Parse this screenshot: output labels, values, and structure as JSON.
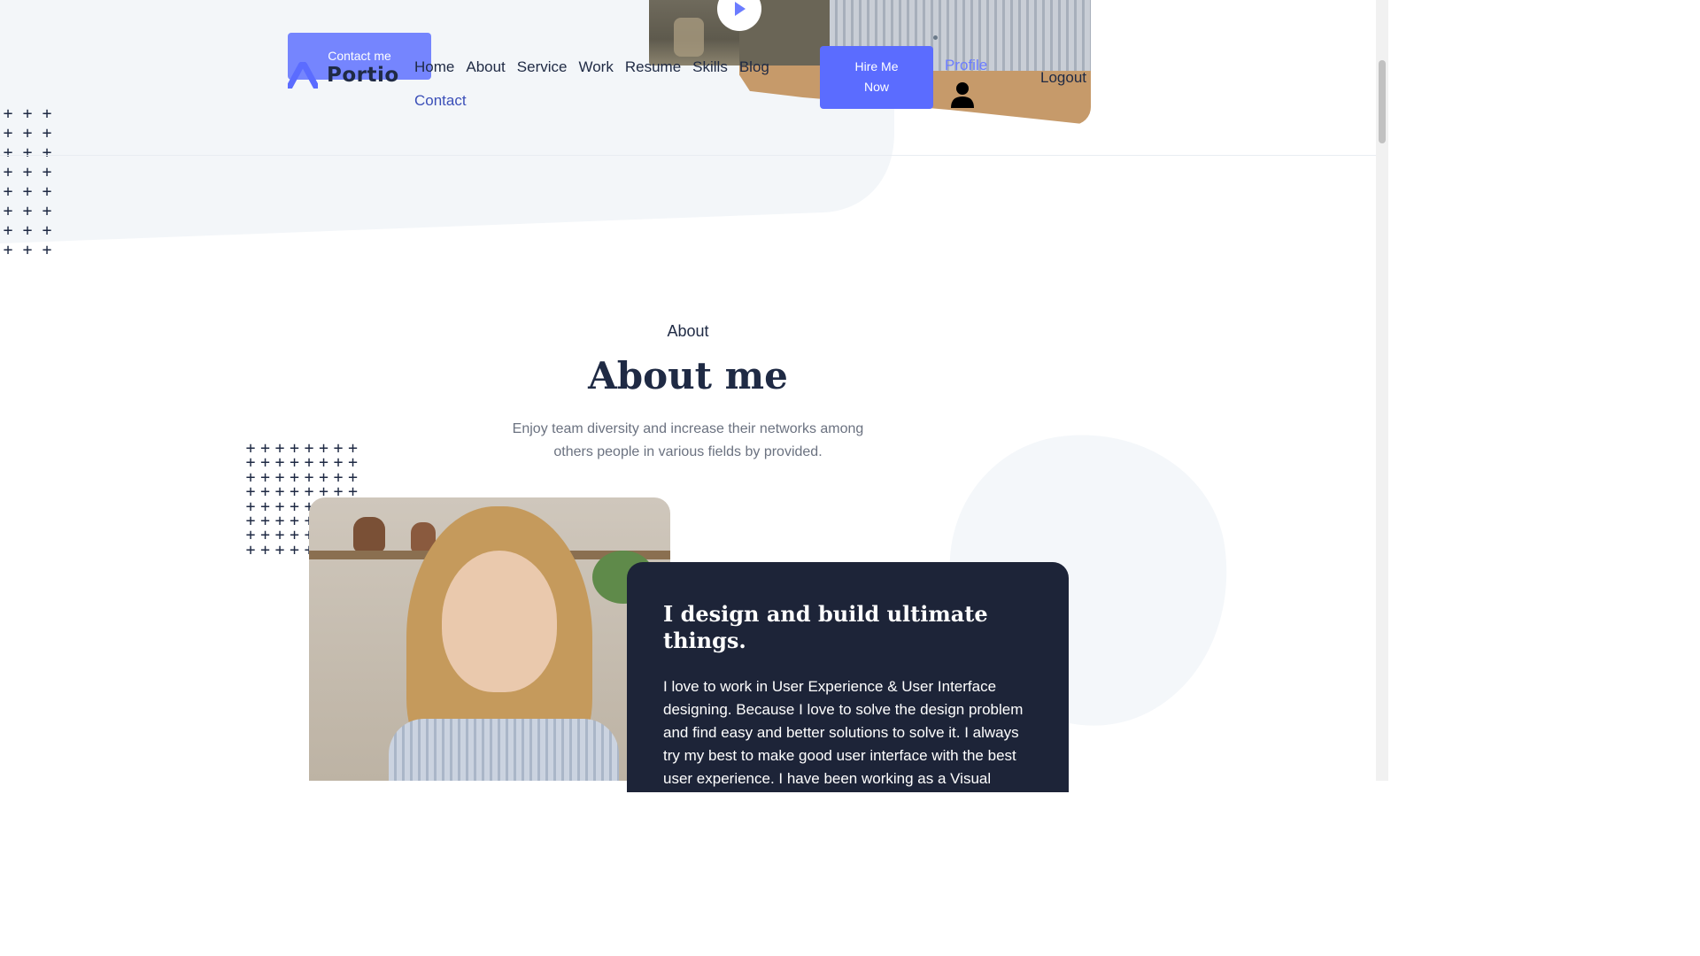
{
  "header": {
    "contact_button": "Contact me",
    "logo_text": "Portio",
    "nav": [
      "Home",
      "About",
      "Service",
      "Work",
      "Resume",
      "Skills",
      "Blog"
    ],
    "nav_second_row": "Contact",
    "hire_button_line1": "Hire Me",
    "hire_button_line2": "Now",
    "profile_link": "Profile",
    "logout_link": "Logout"
  },
  "about": {
    "eyebrow": "About",
    "title": "About me",
    "description": "Enjoy team diversity and increase their networks among others people in various fields by provided.",
    "card_title": "I design and build ultimate things.",
    "card_text": "I love to work in User Experience & User Interface designing. Because I love to solve the design problem and find easy and better solutions to solve it. I always try my best to make good user interface with the best user experience. I have been working as a Visual designer"
  },
  "colors": {
    "accent": "#5b6cff",
    "dark": "#1d2438",
    "text": "#1f2a44",
    "muted": "#6b7280",
    "hero_bg": "#f3f6f9"
  },
  "icons": [
    "play-icon",
    "user-icon",
    "logo-icon",
    "plus-pattern"
  ]
}
